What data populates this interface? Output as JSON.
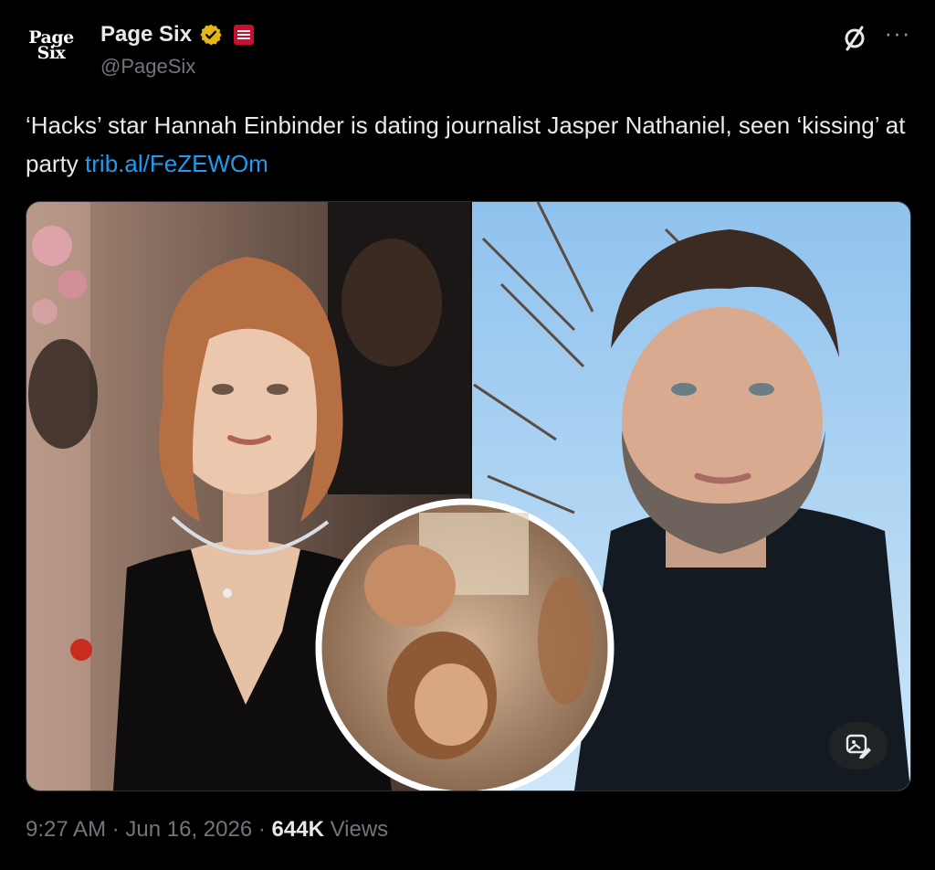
{
  "author": {
    "avatar_line1": "Page",
    "avatar_line2": "Six",
    "display_name": "Page Six",
    "handle": "@PageSix"
  },
  "tweet": {
    "text": "‘Hacks’ star Hannah Einbinder is dating journalist Jasper Nathaniel, seen ‘kissing’ at party",
    "link": "trib.al/FeZEWOm"
  },
  "meta": {
    "time": "9:27 AM",
    "separator": "·",
    "date": "Jun 16, 2026",
    "views_count": "644K",
    "views_label": "Views"
  },
  "icons": {
    "verified": "verified-badge-icon",
    "affiliate": "affiliate-badge-icon",
    "grok": "grok-icon",
    "more": "more-icon",
    "alt": "image-alt-icon"
  },
  "colors": {
    "background": "#000000",
    "text": "#e7e9ea",
    "secondary": "#71767b",
    "link": "#1d9bf0",
    "verified_gold": "#e2b719",
    "affiliate_red": "#c8102e"
  }
}
